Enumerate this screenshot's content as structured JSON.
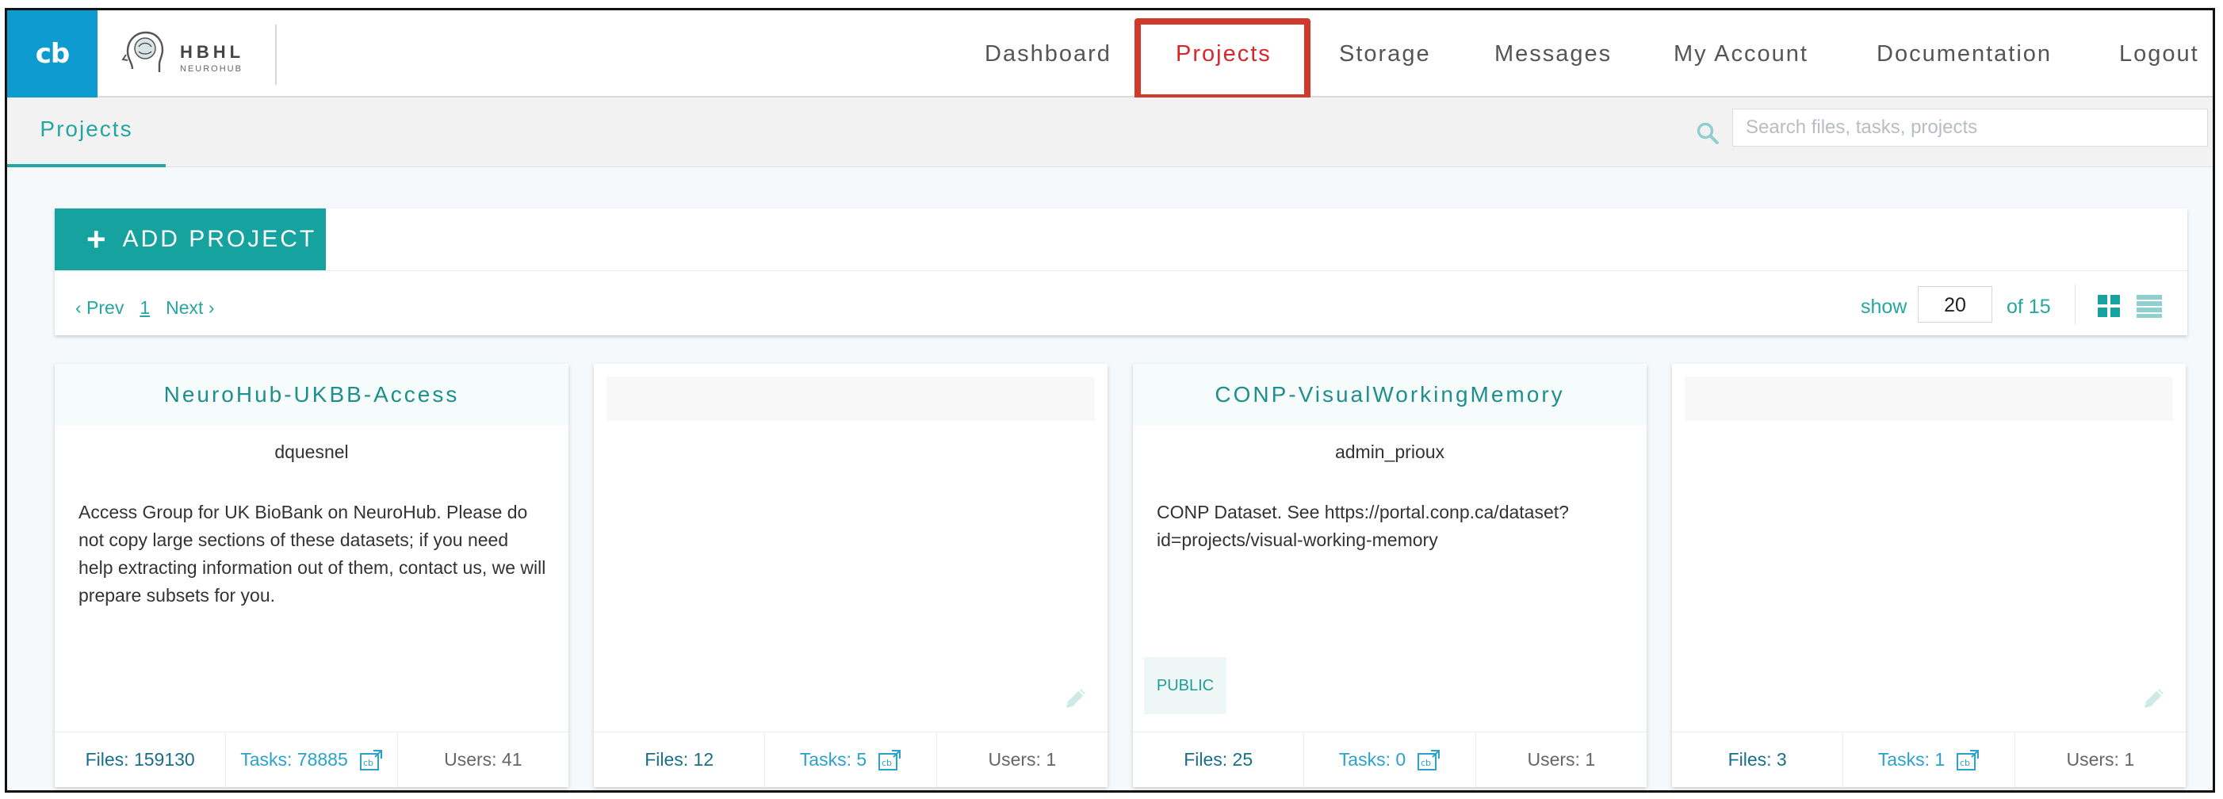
{
  "brand": {
    "cb_logo_text": "cb",
    "hbhl_title": "HBHL",
    "hbhl_subtitle": "NEUROHUB"
  },
  "nav": {
    "items": [
      {
        "label": "Dashboard"
      },
      {
        "label": "Projects",
        "active": true
      },
      {
        "label": "Storage"
      },
      {
        "label": "Messages"
      },
      {
        "label": "My Account"
      },
      {
        "label": "Documentation"
      },
      {
        "label": "Logout"
      }
    ]
  },
  "subbar": {
    "tab_label": "Projects",
    "search_placeholder": "Search files, tasks, projects"
  },
  "toolbar": {
    "add_label": "ADD PROJECT",
    "prev_label": "‹ Prev",
    "page": "1",
    "next_label": "Next ›",
    "show_label": "show",
    "show_value": "20",
    "of_label": "of 15"
  },
  "projects": [
    {
      "title": "NeuroHub-UKBB-Access",
      "owner": "dquesnel",
      "description": "Access Group for UK BioBank on NeuroHub. Please do not copy large sections of these datasets; if you need help extracting information out of them, contact us, we will prepare subsets for you.",
      "files": "Files: 159130",
      "tasks": "Tasks: 78885",
      "users": "Users: 41"
    },
    {
      "title": "",
      "owner": "",
      "description": "",
      "files": "Files: 12",
      "tasks": "Tasks: 5",
      "users": "Users: 1"
    },
    {
      "title": "CONP-VisualWorkingMemory",
      "owner": "admin_prioux",
      "description": "CONP Dataset. See https://portal.conp.ca/dataset?id=projects/visual-working-memory",
      "badge": "PUBLIC",
      "files": "Files: 25",
      "tasks": "Tasks: 0",
      "users": "Users: 1"
    },
    {
      "title": "",
      "owner": "",
      "description": "",
      "files": "Files: 3",
      "tasks": "Tasks: 1",
      "users": "Users: 1"
    }
  ],
  "colors": {
    "accent": "#16a3a0",
    "active_nav": "#d9262b",
    "logo_blue": "#0d9bd0",
    "highlight_box": "#cf3a2c"
  }
}
